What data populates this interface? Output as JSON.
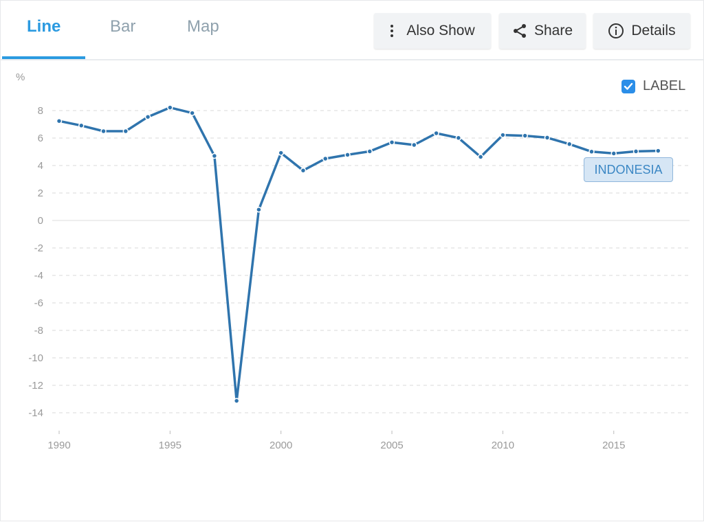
{
  "tabs": [
    {
      "label": "Line",
      "active": true
    },
    {
      "label": "Bar",
      "active": false
    },
    {
      "label": "Map",
      "active": false
    }
  ],
  "toolbar": {
    "also_show": {
      "label": "Also Show",
      "icon": "more-vertical-icon"
    },
    "share": {
      "label": "Share",
      "icon": "share-icon"
    },
    "details": {
      "label": "Details",
      "icon": "info-icon"
    }
  },
  "label_toggle": {
    "label": "LABEL",
    "checked": true
  },
  "colors": {
    "accent": "#2b9ae0",
    "series": "#2f74ad",
    "grid": "#d9d9d9"
  },
  "chart_data": {
    "type": "line",
    "title": "",
    "xlabel": "",
    "ylabel": "%",
    "x": [
      1990,
      1991,
      1992,
      1993,
      1994,
      1995,
      1996,
      1997,
      1998,
      1999,
      2000,
      2001,
      2002,
      2003,
      2004,
      2005,
      2006,
      2007,
      2008,
      2009,
      2010,
      2011,
      2012,
      2013,
      2014,
      2015,
      2016,
      2017
    ],
    "series": [
      {
        "name": "INDONESIA",
        "values": [
          7.24,
          6.91,
          6.5,
          6.5,
          7.54,
          8.22,
          7.82,
          4.7,
          -13.13,
          0.79,
          4.92,
          3.64,
          4.5,
          4.78,
          5.03,
          5.69,
          5.5,
          6.35,
          6.01,
          4.63,
          6.22,
          6.17,
          6.03,
          5.56,
          5.01,
          4.88,
          5.03,
          5.07
        ]
      }
    ],
    "xlim": [
      1990,
      2018
    ],
    "ylim": [
      -15,
      9
    ],
    "yticks": [
      8,
      6,
      4,
      2,
      0,
      -2,
      -4,
      -6,
      -8,
      -10,
      -12,
      -14
    ],
    "xticks": [
      1990,
      1995,
      2000,
      2005,
      2010,
      2015
    ],
    "grid": true,
    "legend": "inline-label"
  }
}
